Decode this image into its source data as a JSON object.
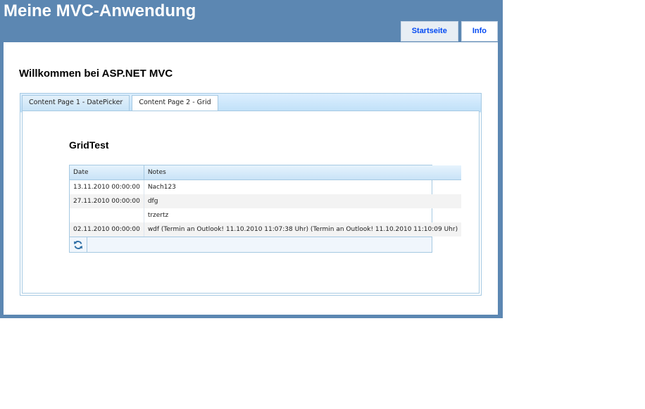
{
  "site": {
    "title": "Meine MVC-Anwendung",
    "menu": [
      "Startseite",
      "Info"
    ]
  },
  "page": {
    "heading": "Willkommen bei ASP.NET MVC"
  },
  "tabs": [
    "Content Page 1 - DatePicker",
    "Content Page 2 - Grid"
  ],
  "active_tab": 1,
  "grid": {
    "title": "GridTest",
    "columns": [
      "Date",
      "Notes"
    ],
    "rows": [
      {
        "date": "13.11.2010 00:00:00",
        "notes": "Nach123"
      },
      {
        "date": "27.11.2010 00:00:00",
        "notes": "dfg"
      },
      {
        "date": "",
        "notes": "trzertz"
      },
      {
        "date": "02.11.2010 00:00:00",
        "notes": "wdf (Termin an Outlook! 11.10.2010 11:07:38 Uhr) (Termin an Outlook! 11.10.2010 11:10:09 Uhr)"
      }
    ],
    "pager_icon": "refresh-icon"
  },
  "colors": {
    "header_bg": "#5c87b2",
    "menu_text": "#034af3",
    "tab_border": "#a6c9e2"
  }
}
